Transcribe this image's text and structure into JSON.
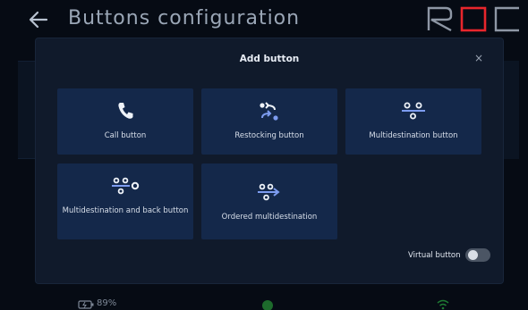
{
  "background": {
    "title": "Buttons configuration",
    "logo_text": "ROC",
    "battery": "89%"
  },
  "modal": {
    "title": "Add button",
    "close_symbol": "×",
    "buttons": [
      {
        "label": "Call button",
        "icon": "phone-icon"
      },
      {
        "label": "Restocking button",
        "icon": "restocking-icon"
      },
      {
        "label": "Multidestination button",
        "icon": "multidestination-icon"
      },
      {
        "label": "Multidestination and back button",
        "icon": "multidestination-back-icon"
      },
      {
        "label": "Ordered multidestination",
        "icon": "ordered-multidestination-icon"
      }
    ],
    "virtual_button": {
      "label": "Virtual button",
      "enabled": false
    }
  },
  "colors": {
    "background": "#060b14",
    "modal": "#101a2b",
    "card": "#14284a",
    "logo_red": "#e8262c",
    "icon_blue": "#7d9cf0"
  }
}
